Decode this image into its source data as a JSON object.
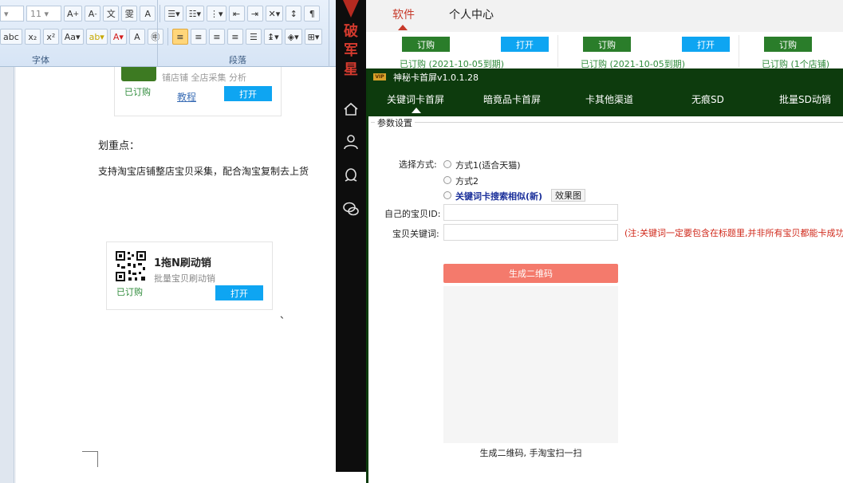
{
  "word": {
    "font_size": "11",
    "group_font": "字体",
    "group_paragraph": "段落",
    "card1": {
      "desc": "铺店铺 全店采集 分析",
      "ordered": "已订购",
      "tutorial": "教程",
      "open": "打开"
    },
    "text1": "划重点：",
    "text2": "支持淘宝店铺整店宝贝采集，配合淘宝复制去上货",
    "card2": {
      "name": "1拖N刷动销",
      "sub": "批量宝贝刷动销",
      "ordered": "已订购",
      "open": "打开"
    },
    "tick": "、"
  },
  "sidebar": {
    "brand": [
      "破",
      "军",
      "星"
    ],
    "icons": [
      "home-icon",
      "user-icon",
      "qq-icon",
      "wechat-icon"
    ],
    "accent": "#d43a2e"
  },
  "topbar": {
    "tabs": [
      {
        "label": "软件",
        "active": true
      },
      {
        "label": "个人中心",
        "active": false
      }
    ]
  },
  "strip": {
    "buy_label": "订购",
    "open_label": "打开",
    "status1": "已订购 (2021-10-05到期)",
    "status2": "已订购 (2021-10-05到期)",
    "status3": "已订购 (1个店铺)"
  },
  "tool": {
    "vip": "VIP",
    "title": "神秘卡首屏v1.0.1.28",
    "tabs": [
      "关键词卡首屏",
      "暗竟品卡首屏",
      "卡其他渠道",
      "无痕SD",
      "批量SD动销"
    ],
    "group_title": "参数设置",
    "method_label": "选择方式:",
    "options": [
      "方式1(适合天猫)",
      "方式2",
      "关键词卡搜索相似(新)"
    ],
    "effect_button": "效果图",
    "item_id_label": "自己的宝贝ID:",
    "item_id_value": "",
    "keyword_label": "宝贝关键词:",
    "keyword_value": "",
    "note": "(注:关键词一定要包含在标题里,并非所有宝贝都能卡成功)",
    "generate_button": "生成二维码",
    "hint": "生成二维码, 手淘宝扫一扫",
    "theme_color": "#0d3b0d",
    "button_color": "#f47a6c"
  }
}
